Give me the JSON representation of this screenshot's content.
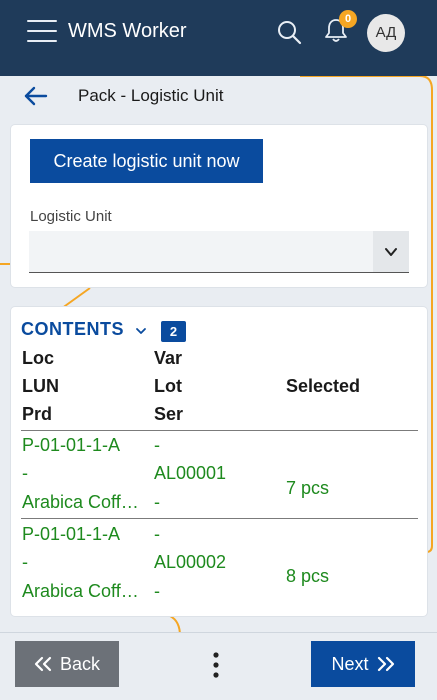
{
  "app": {
    "title": "WMS Worker",
    "notifications_count": "0",
    "avatar_initials": "АД"
  },
  "page": {
    "title": "Pack - Logistic Unit"
  },
  "logistic_unit": {
    "create_button": "Create logistic unit now",
    "label": "Logistic Unit",
    "selected_value": ""
  },
  "contents": {
    "title": "CONTENTS",
    "count": "2",
    "headers": {
      "loc": "Loc",
      "lun": "LUN",
      "prd": "Prd",
      "var": "Var",
      "lot": "Lot",
      "ser": "Ser",
      "selected": "Selected"
    },
    "rows": [
      {
        "loc": "P-01-01-1-A",
        "lun": "-",
        "prd": "Arabica Coff…",
        "var": "-",
        "lot": "AL00001",
        "ser": "-",
        "selected": "7 pcs"
      },
      {
        "loc": "P-01-01-1-A",
        "lun": "-",
        "prd": "Arabica Coff…",
        "var": "-",
        "lot": "AL00002",
        "ser": "-",
        "selected": "8 pcs"
      }
    ]
  },
  "footer": {
    "back_label": "Back",
    "next_label": "Next"
  },
  "colors": {
    "topbar": "#1f3b5a",
    "primary": "#0a4b9e",
    "accent": "#f5a623",
    "value_green": "#1e8a1e"
  },
  "icons": [
    "hamburger-icon",
    "search-icon",
    "bell-icon",
    "back-arrow-icon",
    "chevron-down-icon",
    "double-chevron-left-icon",
    "double-chevron-right-icon",
    "more-vertical-icon"
  ]
}
